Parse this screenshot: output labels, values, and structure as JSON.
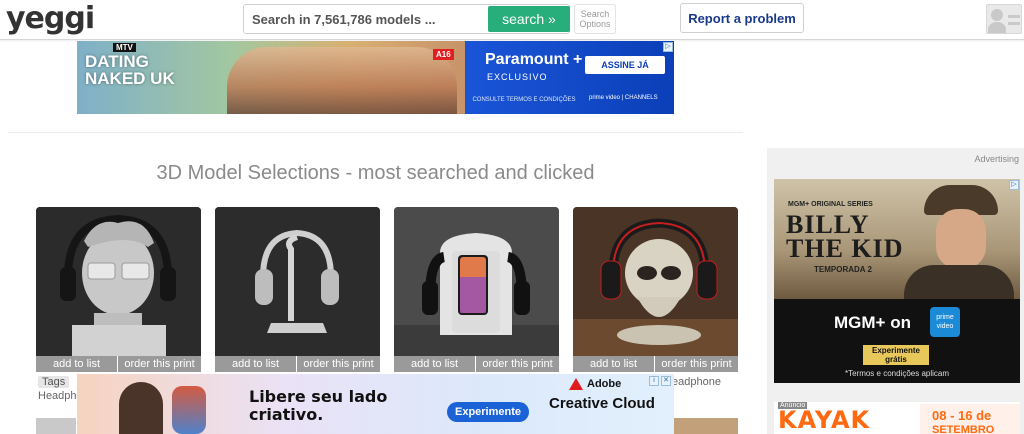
{
  "header": {
    "logo": "yeggi",
    "search_placeholder": "Search in 7,561,786 models ...",
    "search_button": "search »",
    "search_options_line1": "Search",
    "search_options_line2": "Options",
    "report_button": "Report a problem"
  },
  "top_ad": {
    "mtv": "MTV",
    "show_title": "DATING NAKED UK",
    "age_rating": "A16",
    "brand": "Paramount +",
    "exclusive": "EXCLUSIVO",
    "cta": "ASSINE JÁ",
    "terms": "CONSULTE TERMOS E CONDIÇÕES",
    "prime": "prime video | CHANNELS"
  },
  "section": {
    "title": "3D Model Selections - most searched and clicked"
  },
  "cards": [
    {
      "add": "add to list",
      "order": "order this print"
    },
    {
      "add": "add to list",
      "order": "order this print"
    },
    {
      "add": "add to list",
      "order": "order this print"
    },
    {
      "add": "add to list",
      "order": "order this print"
    }
  ],
  "tags": {
    "label": "Tags",
    "frag_left": "Headpho",
    "frag_right": "eadphone"
  },
  "bottom_ad": {
    "headline_line1": "Libere seu lado",
    "headline_line2": "criativo.",
    "cta": "Experimente",
    "brand_top": "Adobe",
    "brand": "Creative Cloud"
  },
  "sidebar": {
    "advertising": "Advertising",
    "ad": {
      "series": "MGM+ ORIGINAL SERIES",
      "title_line1": "BILLY",
      "title_line2": "THE KID",
      "season": "TEMPORADA 2",
      "network": "MGM+ on",
      "prime": "prime video",
      "cta": "Experimente grátis",
      "terms": "*Termos e condições aplicam"
    },
    "ad2": {
      "tag": "Anúncio",
      "brand": "KAYAK",
      "date1": "08 - 16 de",
      "date2": "SETEMBRO"
    }
  },
  "colors": {
    "search_green": "#27ae7a",
    "report_blue": "#1a3a8a",
    "kayak_orange": "#ff690f"
  }
}
